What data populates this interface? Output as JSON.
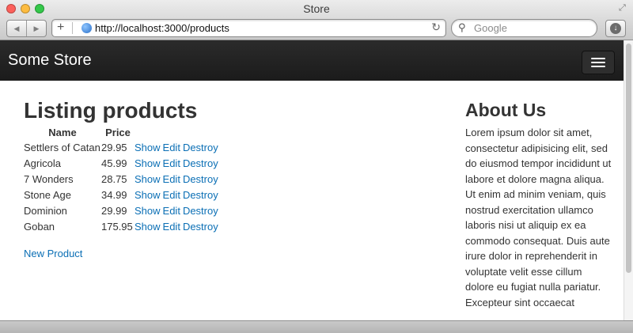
{
  "window": {
    "title": "Store"
  },
  "toolbar": {
    "url": "http://localhost:3000/products",
    "search_placeholder": "Google"
  },
  "navbar": {
    "brand": "Some Store"
  },
  "main": {
    "title": "Listing products",
    "columns": [
      "Name",
      "Price"
    ],
    "products": [
      {
        "name": "Settlers of Catan",
        "price": "29.95"
      },
      {
        "name": "Agricola",
        "price": "45.99"
      },
      {
        "name": "7 Wonders",
        "price": "28.75"
      },
      {
        "name": "Stone Age",
        "price": "34.99"
      },
      {
        "name": "Dominion",
        "price": "29.99"
      },
      {
        "name": "Goban",
        "price": "175.95"
      }
    ],
    "actions": {
      "show": "Show",
      "edit": "Edit",
      "destroy": "Destroy"
    },
    "new_product": "New Product"
  },
  "sidebar": {
    "title": "About Us",
    "text": "Lorem ipsum dolor sit amet, consectetur adipisicing elit, sed do eiusmod tempor incididunt ut labore et dolore magna aliqua. Ut enim ad minim veniam, quis nostrud exercitation ullamco laboris nisi ut aliquip ex ea commodo consequat. Duis aute irure dolor in reprehenderit in voluptate velit esse cillum dolore eu fugiat nulla pariatur. Excepteur sint occaecat"
  },
  "colors": {
    "link": "#0b6fb5",
    "navbar": "#222222",
    "heading": "#333333"
  }
}
